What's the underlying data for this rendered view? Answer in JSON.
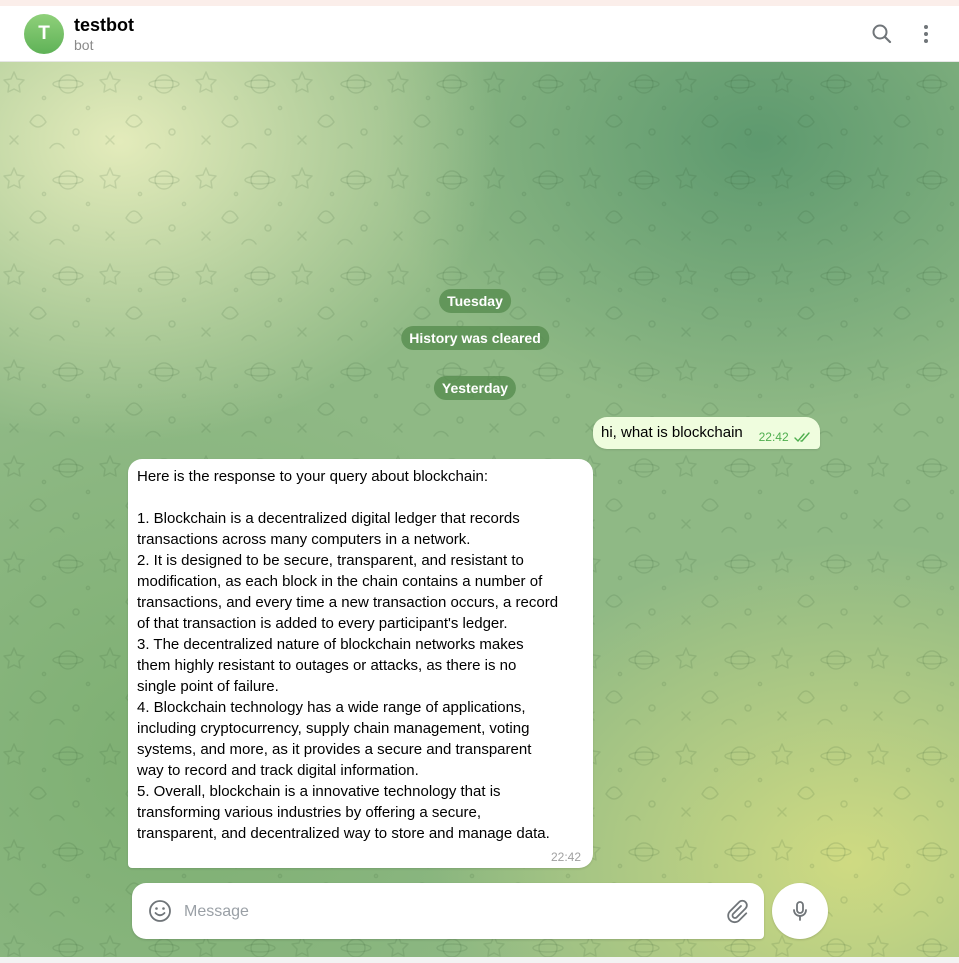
{
  "header": {
    "avatar_letter": "T",
    "title": "testbot",
    "subtitle": "bot",
    "icons": [
      "search-icon",
      "more-vertical-icon"
    ]
  },
  "service_messages": [
    "Tuesday",
    "History was cleared",
    "Yesterday"
  ],
  "messages": [
    {
      "direction": "outgoing",
      "text": "hi, what is blockchain",
      "time": "22:42",
      "status": "read"
    },
    {
      "direction": "incoming",
      "lines": [
        "Here is the response to your query about blockchain:",
        "",
        "1. Blockchain is a decentralized digital ledger that records",
        "transactions across many computers in a network.",
        "2. It is designed to be secure, transparent, and resistant to",
        "modification, as each block in the chain contains a number of",
        "transactions, and every time a new transaction occurs, a record",
        "of that transaction is added to every participant's ledger.",
        "3. The decentralized nature of blockchain networks makes",
        "them highly resistant to outages or attacks, as there is no",
        "single point of failure.",
        "4. Blockchain technology has a wide range of applications,",
        "including cryptocurrency, supply chain management, voting",
        "systems, and more, as it provides a secure and transparent",
        "way to record and track digital information.",
        "5. Overall, blockchain is a innovative technology that is",
        "transforming various industries by offering a secure,",
        "transparent, and decentralized way to store and manage data."
      ],
      "time": "22:42"
    }
  ],
  "composer": {
    "placeholder": "Message",
    "value": "",
    "icons": [
      "emoji-icon",
      "attach-icon",
      "microphone-icon"
    ]
  },
  "colors": {
    "outgoing_bubble": "#effdde",
    "incoming_bubble": "#ffffff",
    "read_check": "#4fae4e",
    "service_pill": "#568c4e",
    "avatar": "#6fc160"
  }
}
